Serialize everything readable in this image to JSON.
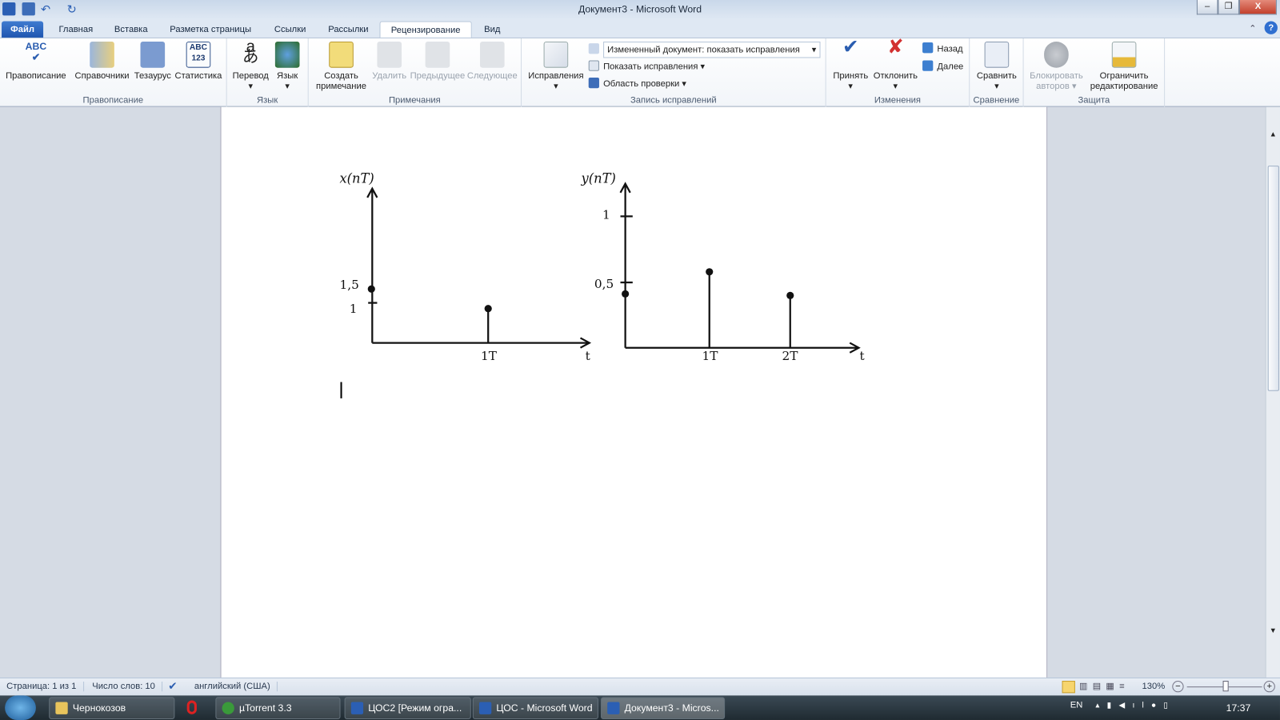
{
  "window": {
    "title": "Документ3 - Microsoft Word",
    "minimize": "–",
    "restore": "❐",
    "close": "X"
  },
  "tabs": [
    "Файл",
    "Главная",
    "Вставка",
    "Разметка страницы",
    "Ссылки",
    "Рассылки",
    "Рецензирование",
    "Вид"
  ],
  "ribbon": {
    "groups": [
      "Правописание",
      "Язык",
      "Примечания",
      "Запись исправлений",
      "Изменения",
      "Сравнение",
      "Защита"
    ],
    "spelling": "Правописание",
    "research": "Справочники",
    "thesaurus": "Тезаурус",
    "stats": "Статистика",
    "translate": "Перевод",
    "language": "Язык",
    "new_comment_1": "Создать",
    "new_comment_2": "примечание",
    "delete": "Удалить",
    "previous": "Предыдущее",
    "next": "Следующее",
    "track": "Исправления",
    "display_select": "Измененный документ: показать исправления",
    "show_markup": "Показать исправления",
    "review_pane": "Область проверки",
    "accept": "Принять",
    "reject": "Отклонить",
    "back": "Назад",
    "forward": "Далее",
    "compare": "Сравнить",
    "block_1": "Блокировать",
    "block_2": "авторов",
    "restrict_1": "Ограничить",
    "restrict_2": "редактирование"
  },
  "document": {
    "left_plot": {
      "ylabel": "x(nT)",
      "ticks": [
        "1,5",
        "1"
      ],
      "xtick": "1T",
      "xlabel": "t"
    },
    "right_plot": {
      "ylabel": "y(nT)",
      "ticks": [
        "1",
        "0,5"
      ],
      "xticks": [
        "1T",
        "2T"
      ],
      "xlabel": "t"
    }
  },
  "status": {
    "page": "Страница: 1 из 1",
    "words": "Число слов: 10",
    "language": "английский (США)",
    "zoom": "130%"
  },
  "taskbar": {
    "items": [
      "Чернокозов",
      "µTorrent 3.3",
      "ЦОС2 [Режим огра...",
      "ЦОС - Microsoft Word",
      "Документ3 - Micros..."
    ],
    "lang": "EN",
    "time": "17:37"
  }
}
